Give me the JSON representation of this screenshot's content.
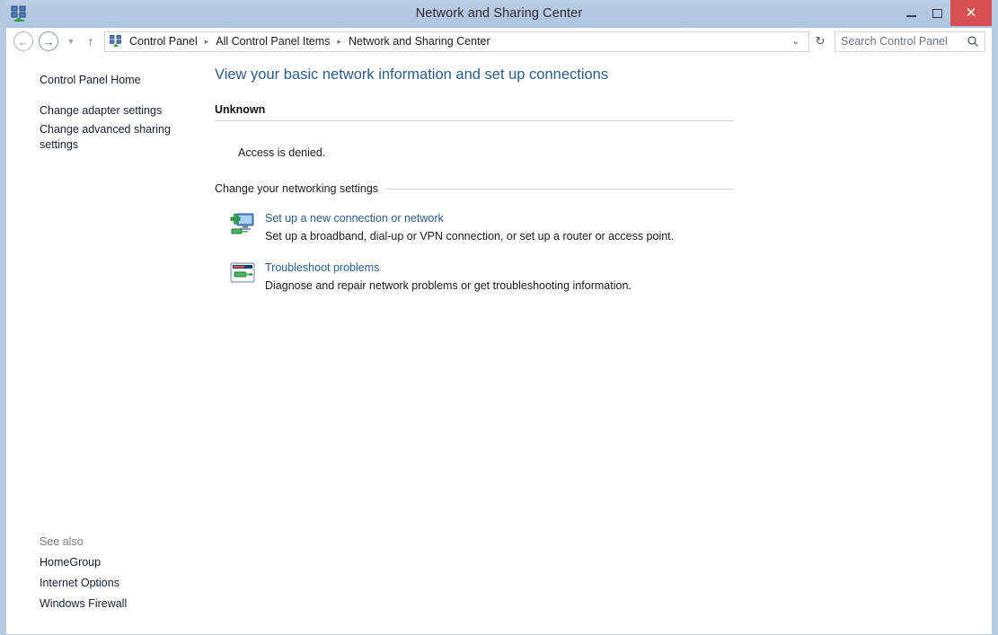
{
  "window": {
    "title": "Network and Sharing Center",
    "icon": "network-icon",
    "controls": {
      "minimize": "minimize-icon",
      "maximize": "maximize-icon",
      "close": "close-icon"
    },
    "frame_color": "#b6cae4",
    "titlebar_color": "#b3c8e2",
    "close_color": "#d65151"
  },
  "addressbar": {
    "back": "back-arrow-icon",
    "back_glyph": "←",
    "forward": "forward-arrow-icon",
    "forward_glyph": "→",
    "recent_dropdown_glyph": "▼",
    "up_glyph": "↑",
    "breadcrumb_icon": "network-icon",
    "breadcrumbs": [
      "Control Panel",
      "All Control Panel Items",
      "Network and Sharing Center"
    ],
    "separator_glyph": "▸",
    "history_chevron_glyph": "⌄",
    "refresh_glyph": "↻",
    "search": {
      "value": "",
      "placeholder": "Search Control Panel",
      "icon": "search-icon"
    }
  },
  "sidebar": {
    "home_label": "Control Panel Home",
    "items": [
      {
        "label": "Change adapter settings"
      },
      {
        "label": "Change advanced sharing settings"
      }
    ],
    "see_also": {
      "label": "See also",
      "items": [
        {
          "label": "HomeGroup"
        },
        {
          "label": "Internet Options"
        },
        {
          "label": "Windows Firewall"
        }
      ]
    }
  },
  "main": {
    "heading": "View your basic network information and set up connections",
    "network_name": "Unknown",
    "access_message": "Access is denied.",
    "section_title": "Change your networking settings",
    "actions": [
      {
        "icon": "add-connection-icon",
        "link": "Set up a new connection or network",
        "description": "Set up a broadband, dial-up or VPN connection, or set up a router or access point."
      },
      {
        "icon": "troubleshoot-icon",
        "link": "Troubleshoot problems",
        "description": "Diagnose and repair network problems or get troubleshooting information."
      }
    ],
    "heading_color": "#2a5c8a",
    "link_color": "#2a5c8a"
  }
}
